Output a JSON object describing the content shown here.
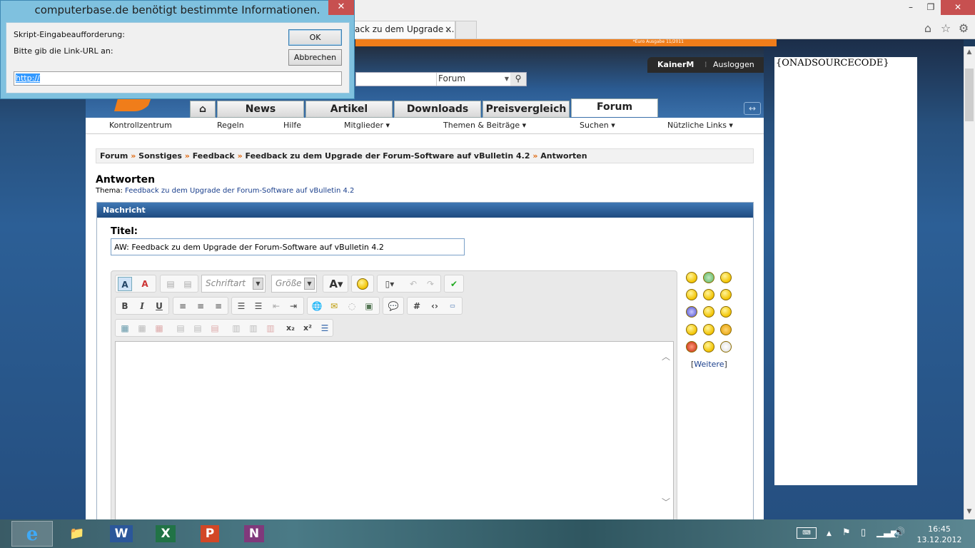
{
  "browser": {
    "tab_title": "ack zu dem Upgrade ...",
    "tab_close": "×",
    "minimize": "–",
    "restore": "❐",
    "close": "✕",
    "ad_banner_text": "*Euro Ausgabe 11/2011"
  },
  "header": {
    "username": "KainerM",
    "logout": "Ausloggen",
    "search_scope": "Forum"
  },
  "nav": {
    "tabs": [
      "News",
      "Artikel",
      "Downloads",
      "Preisvergleich",
      "Forum"
    ],
    "home_icon": "home-icon"
  },
  "subnav": {
    "items": [
      "Kontrollzentrum",
      "Regeln",
      "Hilfe",
      "Mitglieder ▾",
      "Themen & Beiträge ▾",
      "Suchen ▾",
      "Nützliche Links ▾"
    ]
  },
  "breadcrumb": {
    "items": [
      "Forum",
      "Sonstiges",
      "Feedback",
      "Feedback zu dem Upgrade der Forum-Software auf vBulletin 4.2",
      "Antworten"
    ],
    "separator": "»"
  },
  "page": {
    "title": "Antworten",
    "thema_label": "Thema:",
    "thema_link": "Feedback zu dem Upgrade der Forum-Software auf vBulletin 4.2"
  },
  "message": {
    "header": "Nachricht",
    "titel_label": "Titel:",
    "titel_value": "AW: Feedback zu dem Upgrade der Forum-Software auf vBulletin 4.2",
    "font_placeholder": "Schriftart",
    "size_placeholder": "Größe",
    "more_smilies": "Weitere"
  },
  "ad": {
    "text": "{ONADSOURCECODE}"
  },
  "dialog": {
    "title": "computerbase.de benötigt bestimmte Informationen.",
    "close": "✕",
    "label1": "Skript-Eingabeaufforderung:",
    "label2": "Bitte gib die Link-URL an:",
    "ok": "OK",
    "cancel": "Abbrechen",
    "input_value": "http://"
  },
  "taskbar": {
    "time": "16:45",
    "date": "13.12.2012",
    "apps": [
      "e",
      "📁",
      "W",
      "X",
      "P",
      "N"
    ]
  }
}
